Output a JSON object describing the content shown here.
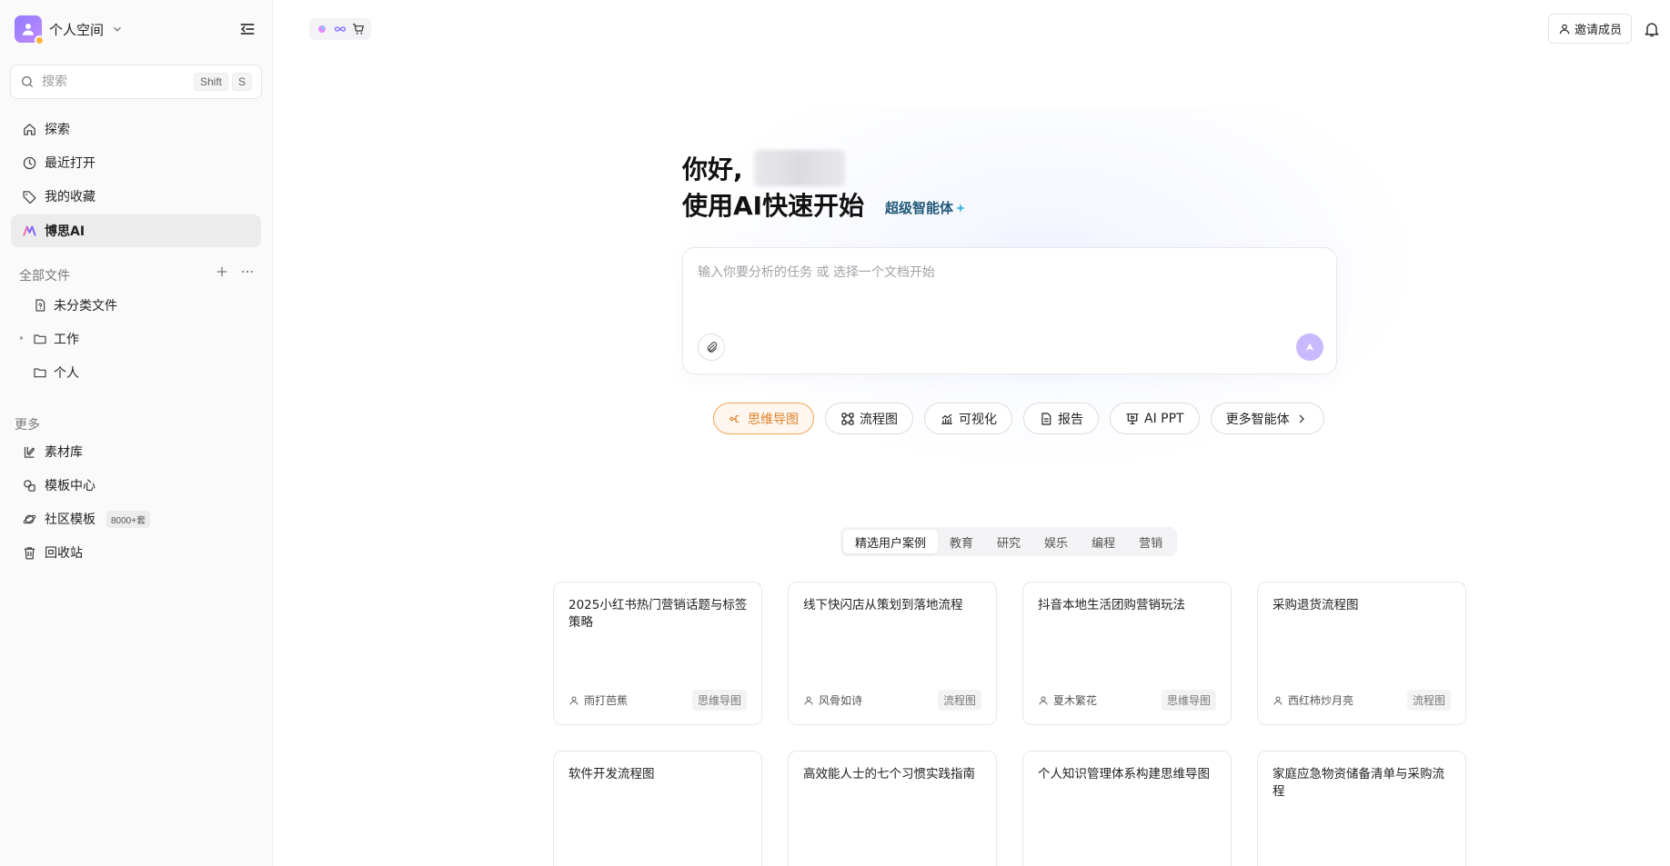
{
  "workspace": {
    "name": "个人空间"
  },
  "search": {
    "placeholder": "搜索",
    "shortcut": [
      "Shift",
      "S"
    ]
  },
  "nav": {
    "explore": "探索",
    "recent": "最近打开",
    "favorites": "我的收藏",
    "boardmix_ai": "博思AI"
  },
  "files": {
    "section_label": "全部文件",
    "items": [
      "未分类文件",
      "工作",
      "个人"
    ]
  },
  "more": {
    "section_label": "更多",
    "assets": "素材库",
    "templates": "模板中心",
    "community": "社区模板",
    "community_badge": "8000+套",
    "trash": "回收站"
  },
  "topbar": {
    "invite_label": "邀请成员"
  },
  "hero": {
    "greeting": "你好,",
    "subtitle": "使用AI快速开始",
    "super_agent": "超级智能体"
  },
  "prompt": {
    "placeholder": "输入你要分析的任务 或 选择一个文档开始"
  },
  "chips": [
    "思维导图",
    "流程图",
    "可视化",
    "报告",
    "AI PPT",
    "更多智能体"
  ],
  "categories": [
    "精选用户案例",
    "教育",
    "研究",
    "娱乐",
    "编程",
    "营销"
  ],
  "cards": [
    {
      "title": "2025小红书热门营销话题与标签策略",
      "author": "雨打芭蕉",
      "tag": "思维导图"
    },
    {
      "title": "线下快闪店从策划到落地流程",
      "author": "风骨如诗",
      "tag": "流程图"
    },
    {
      "title": "抖音本地生活团购营销玩法",
      "author": "夏木繁花",
      "tag": "思维导图"
    },
    {
      "title": "采购退货流程图",
      "author": "西红柿炒月亮",
      "tag": "流程图"
    },
    {
      "title": "软件开发流程图",
      "author": "",
      "tag": ""
    },
    {
      "title": "高效能人士的七个习惯实践指南",
      "author": "",
      "tag": ""
    },
    {
      "title": "个人知识管理体系构建思维导图",
      "author": "",
      "tag": ""
    },
    {
      "title": "家庭应急物资储备清单与采购流程",
      "author": "",
      "tag": ""
    }
  ],
  "colors": {
    "accent": "#e0812a",
    "send_button": "#c9b9ff",
    "super_agent": "#225a7a"
  }
}
